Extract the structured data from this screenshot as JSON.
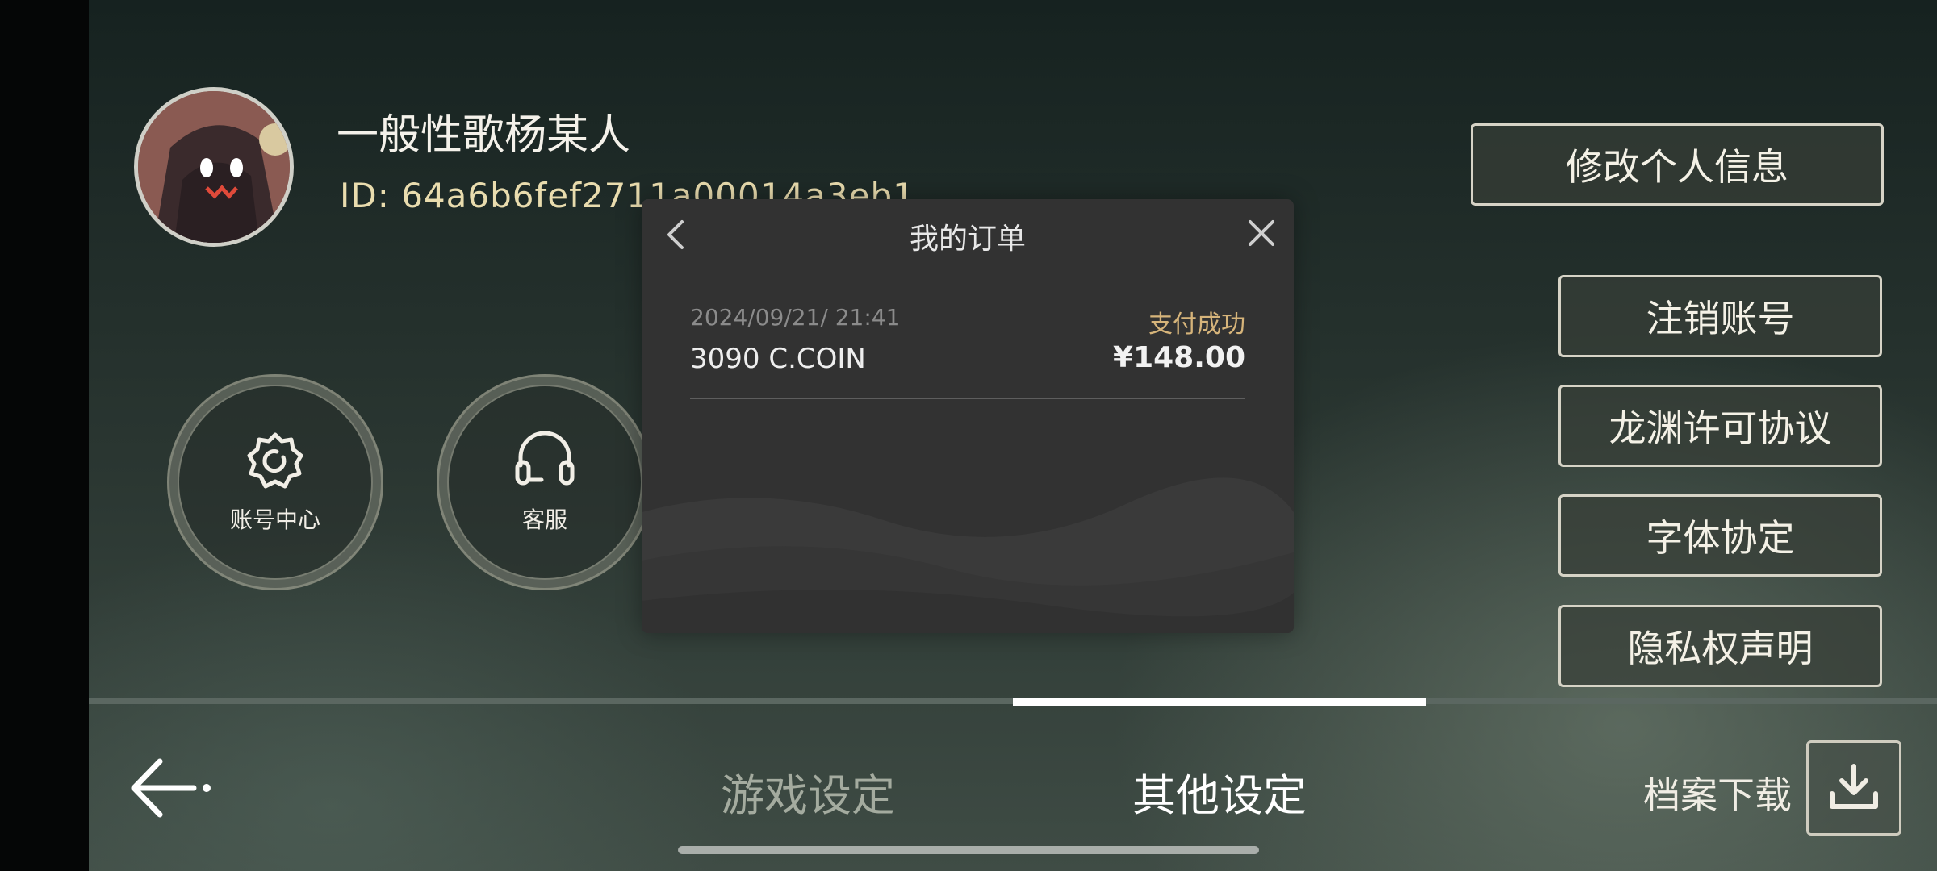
{
  "profile": {
    "username": "一般性歌杨某人",
    "id_text": "ID: 64a6b6fef2711a00014a3eb1"
  },
  "quick_actions": [
    {
      "label": "账号中心",
      "icon": "settings-gear-icon"
    },
    {
      "label": "客服",
      "icon": "headset-icon"
    }
  ],
  "buttons": {
    "edit_profile": "修改个人信息",
    "deactivate": "注销账号",
    "license": "龙渊许可协议",
    "font_agreement": "字体协定",
    "privacy": "隐私权声明"
  },
  "tabs": {
    "game": "游戏设定",
    "other": "其他设定",
    "active": "other"
  },
  "archive": {
    "label": "档案下载",
    "icon": "download-icon"
  },
  "modal": {
    "title": "我的订单",
    "orders": [
      {
        "date": "2024/09/21/ 21:41",
        "status": "支付成功",
        "item": "3090 C.COIN",
        "price": "¥148.00"
      }
    ]
  },
  "colors": {
    "accent_gold": "#e9dcae",
    "status_gold": "#d6b47a",
    "modal_bg": "#323232"
  }
}
